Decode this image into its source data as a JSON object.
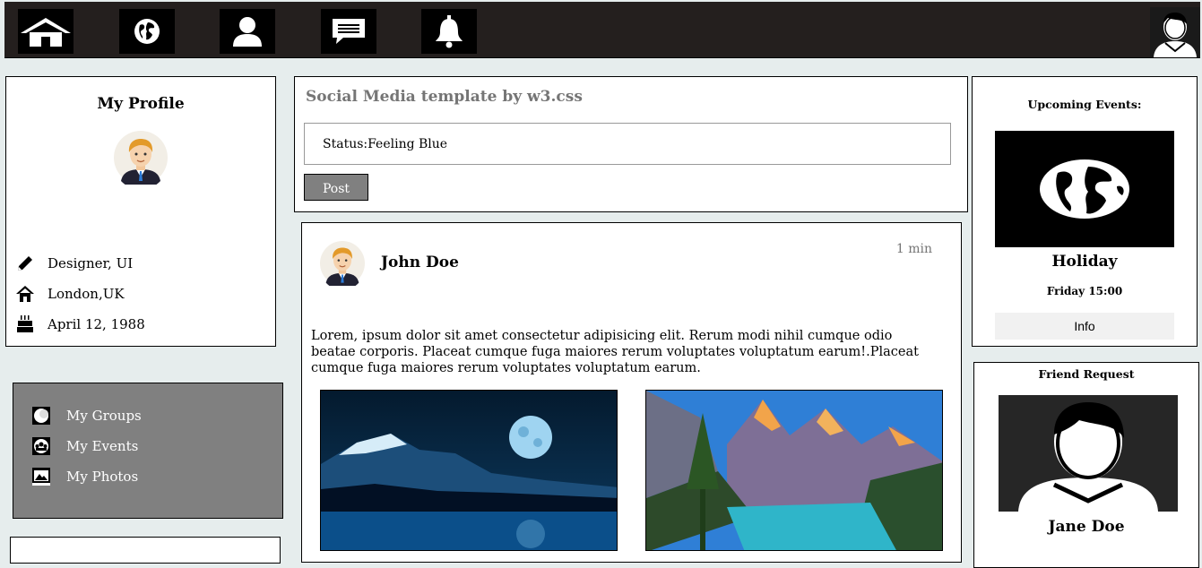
{
  "nav": {
    "items": [
      {
        "icon": "home-icon"
      },
      {
        "icon": "globe-icon"
      },
      {
        "icon": "user-icon"
      },
      {
        "icon": "message-icon"
      },
      {
        "icon": "bell-icon"
      }
    ],
    "account_icon": "avatar-icon"
  },
  "profile": {
    "title": "My Profile",
    "avatar_icon": "avatar-icon",
    "info": [
      {
        "icon": "pencil-icon",
        "text": "Designer, UI"
      },
      {
        "icon": "home-icon",
        "text": "London,UK"
      },
      {
        "icon": "birthday-cake-icon",
        "text": "April 12, 1988"
      }
    ]
  },
  "menu": {
    "items": [
      {
        "icon": "circle-icon",
        "label": "My Groups"
      },
      {
        "icon": "events-icon",
        "label": "My Events"
      },
      {
        "icon": "photo-icon",
        "label": "My Photos"
      }
    ]
  },
  "composer": {
    "title": "Social Media template by w3.css",
    "status_value": "Status:Feeling Blue",
    "post_label": "Post"
  },
  "post": {
    "author": "John Doe",
    "time": "1 min",
    "text": "Lorem, ipsum dolor sit amet consectetur adipisicing elit. Rerum modi nihil cumque odio beatae corporis. Placeat cumque fuga maiores rerum voluptates voluptatum earum!.Placeat cumque fuga maiores rerum voluptates voluptatum earum.",
    "images": [
      "moon-lake-photo",
      "mountain-lake-photo"
    ]
  },
  "events": {
    "title": "Upcoming Events:",
    "name": "Holiday",
    "time": "Friday 15:00",
    "info_label": "Info"
  },
  "friend_request": {
    "title": "Friend Request",
    "name": "Jane Doe"
  },
  "colors": {
    "topbar": "#241f1e",
    "background": "#e6eded",
    "menu_panel": "#808080",
    "button": "#808080"
  }
}
